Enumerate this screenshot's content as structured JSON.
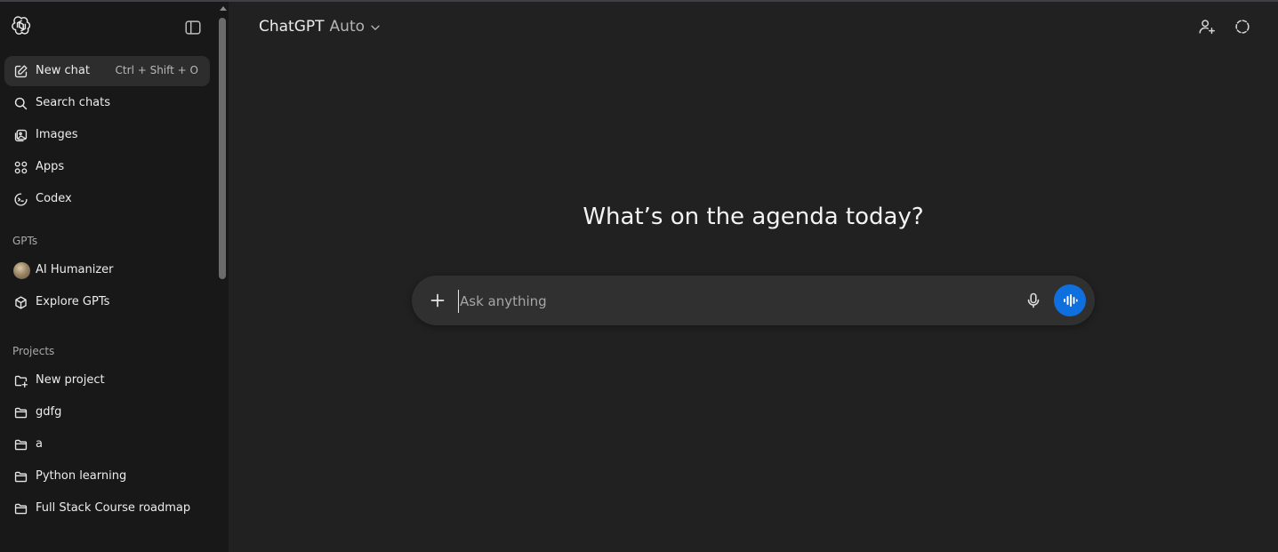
{
  "sidebar": {
    "primary": [
      {
        "label": "New chat",
        "shortcut": "Ctrl + Shift + O",
        "icon": "compose-icon"
      },
      {
        "label": "Search chats",
        "icon": "search-icon"
      },
      {
        "label": "Images",
        "icon": "images-icon"
      },
      {
        "label": "Apps",
        "icon": "apps-grid-icon"
      },
      {
        "label": "Codex",
        "icon": "codex-icon"
      }
    ],
    "gpts_heading": "GPTs",
    "gpts": [
      {
        "label": "AI Humanizer",
        "icon": "avatar"
      },
      {
        "label": "Explore GPTs",
        "icon": "cube-icon"
      }
    ],
    "projects_heading": "Projects",
    "projects": [
      {
        "label": "New project",
        "icon": "new-folder-icon"
      },
      {
        "label": "gdfg",
        "icon": "folder-icon"
      },
      {
        "label": "a",
        "icon": "folder-icon"
      },
      {
        "label": "Python learning",
        "icon": "folder-icon"
      },
      {
        "label": "Full Stack Course roadmap",
        "icon": "folder-icon"
      }
    ]
  },
  "header": {
    "model_name": "ChatGPT",
    "model_mode": "Auto"
  },
  "main": {
    "headline": "What’s on the agenda today?",
    "composer": {
      "placeholder": "Ask anything",
      "value": ""
    }
  },
  "colors": {
    "background": "#212121",
    "sidebar": "#181818",
    "composer": "#303030",
    "accent": "#0f6fde"
  }
}
